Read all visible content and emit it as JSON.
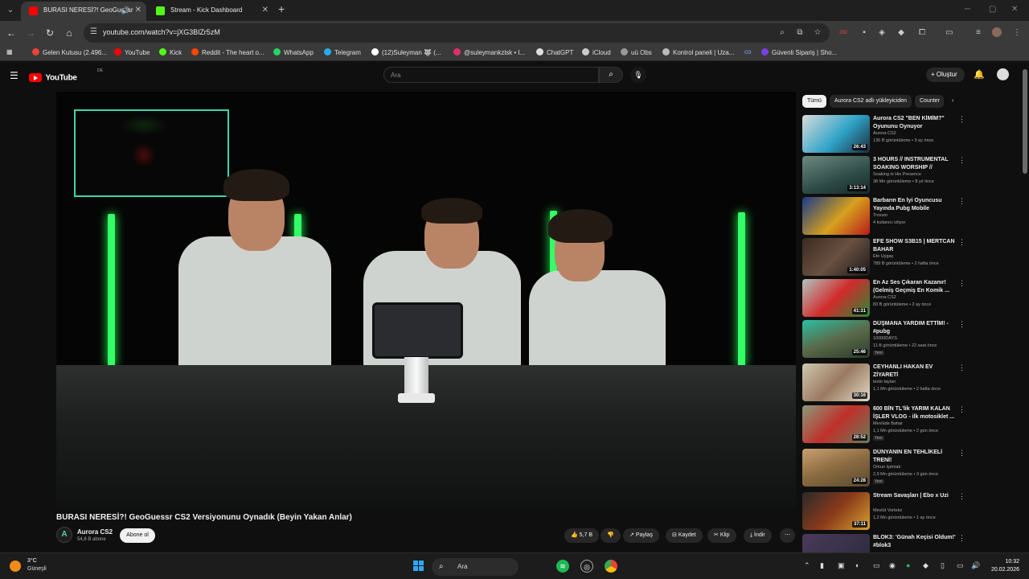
{
  "browser": {
    "tabs": [
      {
        "title": "BURASI NERESİ?! GeoGuessr",
        "active": true
      },
      {
        "title": "Stream - Kick Dashboard",
        "active": false
      }
    ],
    "url": "youtube.com/watch?v=jXG3BlZr5zM",
    "bookmarks": [
      "Gelen Kutusu (2.496...",
      "YouTube",
      "Kick",
      "Reddit - The heart o...",
      "WhatsApp",
      "Telegram",
      "(12)Suleyman 🐺 (...",
      "@suleymankzlsk • I...",
      "ChatGPT",
      "iCloud",
      "uü Obs",
      "Kontrol paneli | Uza...",
      "Güvenli Sipariş | Sho..."
    ],
    "badge_count": "282"
  },
  "youtube": {
    "logo": "YouTube",
    "country": "DE",
    "search_placeholder": "Ara",
    "create_label": "Oluştur",
    "video_title": "BURASI NERESİ?! GeoGuessr CS2 Versiyonunu Oynadık (Beyin Yakan Anlar)",
    "channel_name": "Aurora CS2",
    "channel_subs": "54,6 B abone",
    "subscribe_label": "Abone ol",
    "likes": "5,7 B",
    "share_label": "Paylaş",
    "save_label": "Kaydet",
    "clip_label": "Klip",
    "download_label": "İndir",
    "chips": [
      "Tümü",
      "Aurora CS2 adlı yükleyiciden",
      "Counter"
    ],
    "recommendations": [
      {
        "title": "Aurora CS2 \"BEN KİMİM?\" Oyununu Oynuyor",
        "channel": "Aurora CS2",
        "meta": "136 B görüntüleme • 3 ay önce",
        "duration": "26:43",
        "badge": ""
      },
      {
        "title": "3 HOURS // INSTRUMENTAL SOAKING WORSHIP // BETHE...",
        "channel": "Soaking in His Presence",
        "meta": "38 Mn görüntüleme • 8 yıl önce",
        "duration": "3:13:14",
        "badge": ""
      },
      {
        "title": "Barbarın En İyi Oyuncusu Yayında Pubg Mobile",
        "channel": "Troxsm",
        "meta": "4 kullanıcı izliyor",
        "duration": "",
        "badge": ""
      },
      {
        "title": "EFE SHOW S3B15 | MERTCAN BAHAR",
        "channel": "Efe Uygaç",
        "meta": "789 B görüntüleme • 2 hafta önce",
        "duration": "1:40:05",
        "badge": ""
      },
      {
        "title": "En Az Ses Çıkaran Kazanır! (Gelmiş Geçmiş En Komik ...",
        "channel": "Aurora CS2",
        "meta": "83 B görüntüleme • 2 ay önce",
        "duration": "41:31",
        "badge": ""
      },
      {
        "title": "DÜŞMANA YARDIM ETTİM! - #pubg",
        "channel": "10000DAYS",
        "meta": "11 B görüntüleme • 22 saat önce",
        "duration": "25:46",
        "badge": "Yeni"
      },
      {
        "title": "CEYHANLI HAKAN EV ZİYARETİ",
        "channel": "testo taylan",
        "meta": "1,1 Mn görüntüleme • 2 hafta önce",
        "duration": "30:16",
        "badge": ""
      },
      {
        "title": "600 BİN TL'lik YARIM KALAN İŞLER VLOG - ilk motosiklet ...",
        "channel": "Mevlüde Bahar",
        "meta": "1,1 Mn görüntüleme • 2 gün önce",
        "duration": "28:52",
        "badge": "Yeni"
      },
      {
        "title": "DÜNYANIN EN TEHLİKELİ TRENİ!",
        "channel": "Orkun Işıtmak",
        "meta": "2,9 Mn görüntüleme • 3 gün önce",
        "duration": "24:28",
        "badge": "Yeni"
      },
      {
        "title": "Stream Savaşları | Ebo x Uzi",
        "channel": "Mevlüt Vortekx",
        "meta": "1,2 Mn görüntüleme • 1 ay önce",
        "duration": "37:11",
        "badge": ""
      },
      {
        "title": "BLOK3: 'Günah Keçisi Oldum!' #blok3",
        "channel": "",
        "meta": "",
        "duration": "",
        "badge": ""
      }
    ]
  },
  "taskbar": {
    "temperature": "3°C",
    "weather": "Güneşli",
    "search_label": "Ara",
    "time": "10:32",
    "date": "20.02.2026"
  },
  "colors": {
    "pip_border": "#3dd6b0",
    "neon": "#33ff66",
    "youtube_red": "#ff0000"
  }
}
